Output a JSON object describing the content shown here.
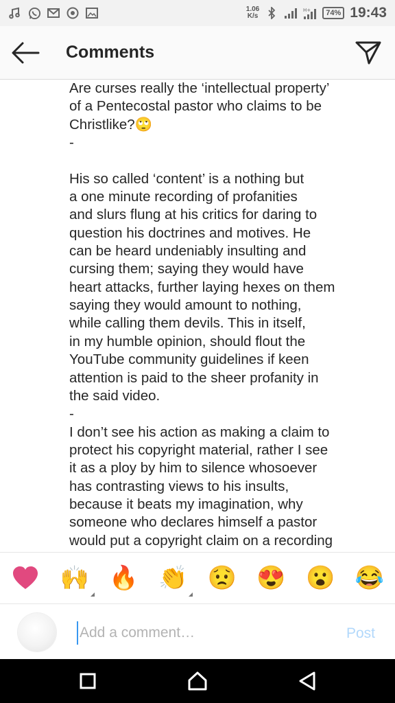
{
  "status_bar": {
    "speed_value": "1.06",
    "speed_unit": "K/s",
    "battery": "74%",
    "time": "19:43",
    "left_icons": [
      "music-icon",
      "whatsapp-icon",
      "gmail-icon",
      "chrome-icon",
      "image-icon"
    ],
    "right_icons": [
      "bluetooth-icon",
      "signal-icon",
      "signal-h-icon",
      "battery-icon"
    ]
  },
  "header": {
    "title": "Comments"
  },
  "comment": {
    "text": "Are curses really the ‘intellectual property’\nof a Pentecostal pastor who claims to be\nChristlike?🙄\n-\n\nHis so called ‘content’ is a nothing but\na one minute recording of profanities\nand slurs flung at his critics for daring to\nquestion his doctrines and motives. He\ncan be heard undeniably insulting and\ncursing them; saying they would have\nheart attacks, further laying hexes on them\nsaying they would amount to nothing,\nwhile calling them devils. This in itself,\nin my humble opinion, should flout the\nYouTube community guidelines if keen\nattention is paid to the sheer profanity in\nthe said video.\n-\nI don’t see his action as making a claim to\nprotect his copyright material, rather I see\nit as a ploy by him to silence whosoever\nhas contrasting views to his insults,\nbecause it beats my imagination, why\nsomeone who declares himself a pastor\nwould put a copyright claim on a recording"
  },
  "emoji_bar": [
    {
      "name": "heart-emoji",
      "glyph": "❤"
    },
    {
      "name": "raising-hands-emoji",
      "glyph": "🙌"
    },
    {
      "name": "fire-emoji",
      "glyph": "🔥"
    },
    {
      "name": "clapping-hands-emoji",
      "glyph": "👏"
    },
    {
      "name": "worried-face-emoji",
      "glyph": "😟"
    },
    {
      "name": "heart-eyes-emoji",
      "glyph": "😍"
    },
    {
      "name": "surprised-face-emoji",
      "glyph": "😮"
    },
    {
      "name": "laughing-face-emoji",
      "glyph": "😂"
    }
  ],
  "input": {
    "placeholder": "Add a comment…",
    "post_label": "Post"
  },
  "colors": {
    "accent": "#3897f0",
    "post_disabled": "#b2d8fb",
    "heart": "#e1497f"
  }
}
